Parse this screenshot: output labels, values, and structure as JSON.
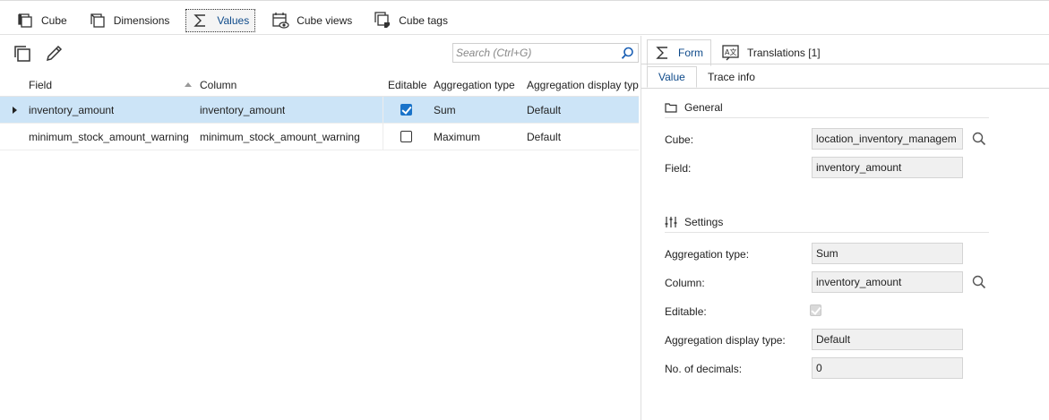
{
  "top_tabs": [
    {
      "label": "Cube",
      "icon": "cube-icon",
      "active": false
    },
    {
      "label": "Dimensions",
      "icon": "dimensions-icon",
      "active": false
    },
    {
      "label": "Values",
      "icon": "sigma-icon",
      "active": true
    },
    {
      "label": "Cube views",
      "icon": "cube-views-icon",
      "active": false
    },
    {
      "label": "Cube tags",
      "icon": "cube-tags-icon",
      "active": false
    }
  ],
  "toolbar": {
    "copy_icon": "copy-icon",
    "edit_icon": "pencil-icon",
    "search_placeholder": "Search (Ctrl+G)",
    "search_icon": "search-icon"
  },
  "grid": {
    "columns": [
      "Field",
      "Column",
      "Editable",
      "Aggregation type",
      "Aggregation display typ"
    ],
    "rows": [
      {
        "field": "inventory_amount",
        "column": "inventory_amount",
        "editable": true,
        "aggregation_type": "Sum",
        "aggregation_display_type": "Default",
        "selected": true
      },
      {
        "field": "minimum_stock_amount_warning",
        "column": "minimum_stock_amount_warning",
        "editable": false,
        "aggregation_type": "Maximum",
        "aggregation_display_type": "Default",
        "selected": false
      }
    ]
  },
  "right_panel": {
    "tabs": [
      {
        "label": "Form",
        "icon": "sigma-icon",
        "active": true
      },
      {
        "label": "Translations [1]",
        "icon": "translate-icon",
        "active": false
      }
    ],
    "subtabs": [
      {
        "label": "Value",
        "active": true
      },
      {
        "label": "Trace info",
        "active": false
      }
    ],
    "general": {
      "title": "General",
      "cube_label": "Cube:",
      "cube_value": "location_inventory_managem",
      "field_label": "Field:",
      "field_value": "inventory_amount"
    },
    "settings": {
      "title": "Settings",
      "aggregation_type_label": "Aggregation type:",
      "aggregation_type_value": "Sum",
      "column_label": "Column:",
      "column_value": "inventory_amount",
      "editable_label": "Editable:",
      "editable_value": true,
      "aggregation_display_type_label": "Aggregation display type:",
      "aggregation_display_type_value": "Default",
      "decimals_label": "No. of decimals:",
      "decimals_value": "0"
    }
  },
  "colors": {
    "selected_row": "#cce4f7",
    "accent": "#1a73c9",
    "active_tab_text": "#0e4a8a"
  }
}
